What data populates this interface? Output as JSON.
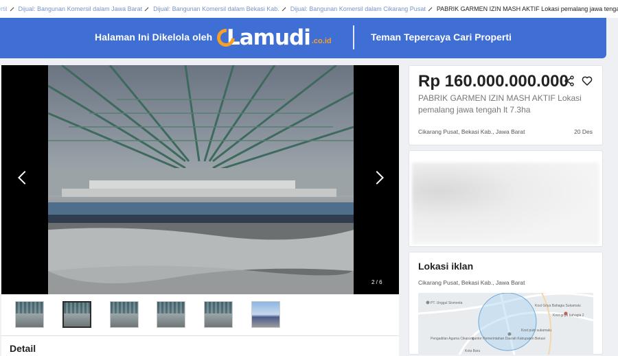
{
  "breadcrumb": {
    "items": [
      "ertil",
      "Dijual: Bangunan Komersil dalam Jawa Barat",
      "Dijual: Bangunan Komersil dalam Bekasi Kab.",
      "Dijual: Bangunan Komersil dalam Cikarang Pusat"
    ],
    "current": "PABRIK GARMEN IZIN MASH AKTIF Lokasi pemalang jawa tengah lt 7.3ha"
  },
  "banner": {
    "left_text": "Halaman Ini Dikelola oleh",
    "logo_text": "Lamudi",
    "logo_tld": ".co.id",
    "right_text": "Teman Tepercaya Cari Properti",
    "colors": {
      "background": "#3f6ed4",
      "accent": "#f7a025"
    }
  },
  "gallery": {
    "counter": "2 / 6",
    "thumbnail_count": 6,
    "active_thumbnail": 2
  },
  "detail": {
    "heading": "Detail"
  },
  "listing": {
    "price": "Rp 160.000.000.000",
    "title": "PABRIK GARMEN IZIN MASH AKTIF Lokasi pemalang jawa tengah lt 7.3ha",
    "location": "Cikarang Pusat, Bekasi Kab., Jawa Barat",
    "date": "20 Des",
    "icons": [
      "share-icon",
      "heart-icon"
    ]
  },
  "location_card": {
    "heading": "Lokasi iklan",
    "location": "Cikarang Pusat, Bekasi Kab., Jawa Barat",
    "map_labels": [
      "PT. Unggul Sismesta",
      "Kost Griya Bahagia Sukamalu",
      "Kost griya bahagia 2",
      "Kost putri sukamalu",
      "Pengadilan Agama Cikarang",
      "Kantor Pemerintahan Daerah Kabupaten Bekasi",
      "Kota Baru"
    ]
  }
}
